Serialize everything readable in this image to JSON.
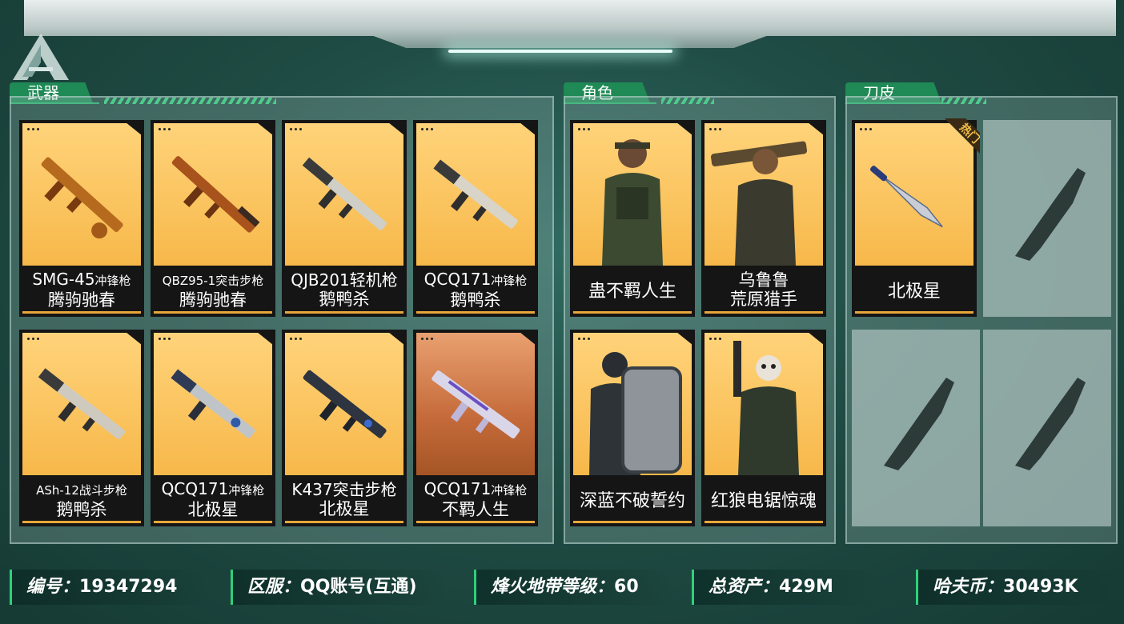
{
  "sections": {
    "weapons": "武器",
    "characters": "角色",
    "knives": "刀皮"
  },
  "weapons": [
    {
      "name": "SMG-45",
      "type": "冲锋枪",
      "skin": "腾驹驰春",
      "bg": "gold"
    },
    {
      "name": "QBZ95-1",
      "type": "突击步枪",
      "skin": "腾驹驰春",
      "bg": "gold"
    },
    {
      "name": "QJB201",
      "type": "轻机枪",
      "skin": "鹅鸭杀",
      "bg": "gold"
    },
    {
      "name": "QCQ171",
      "type": "冲锋枪",
      "skin": "鹅鸭杀",
      "bg": "gold"
    },
    {
      "name": "ASh-12",
      "type": "战斗步枪",
      "skin": "鹅鸭杀",
      "bg": "gold"
    },
    {
      "name": "QCQ171",
      "type": "冲锋枪",
      "skin": "北极星",
      "bg": "gold"
    },
    {
      "name": "K437",
      "type": "突击步枪",
      "skin": "北极星",
      "bg": "gold"
    },
    {
      "name": "QCQ171",
      "type": "冲锋枪",
      "skin": "不羁人生",
      "bg": "orange"
    }
  ],
  "characters": [
    {
      "line1": "",
      "line2": "蛊不羁人生"
    },
    {
      "line1": "乌鲁鲁",
      "line2": "荒原猎手"
    },
    {
      "line1": "",
      "line2": "深蓝不破誓约"
    },
    {
      "line1": "",
      "line2": "红狼电锯惊魂"
    }
  ],
  "knives": [
    {
      "name": "北极星",
      "badge": "热门"
    }
  ],
  "footer": {
    "id_label": "编号：",
    "id_value": "19347294",
    "server_label": "区服：",
    "server_value": "QQ账号(互通)",
    "level_label": "烽火地带等级：",
    "level_value": "60",
    "assets_label": "总资产：",
    "assets_value": "429M",
    "coin_label": "哈夫币：",
    "coin_value": "30493K"
  },
  "colors": {
    "accent": "#1f8a55",
    "card_gold": "#f7b84a",
    "card_orange": "#c56a3a"
  }
}
